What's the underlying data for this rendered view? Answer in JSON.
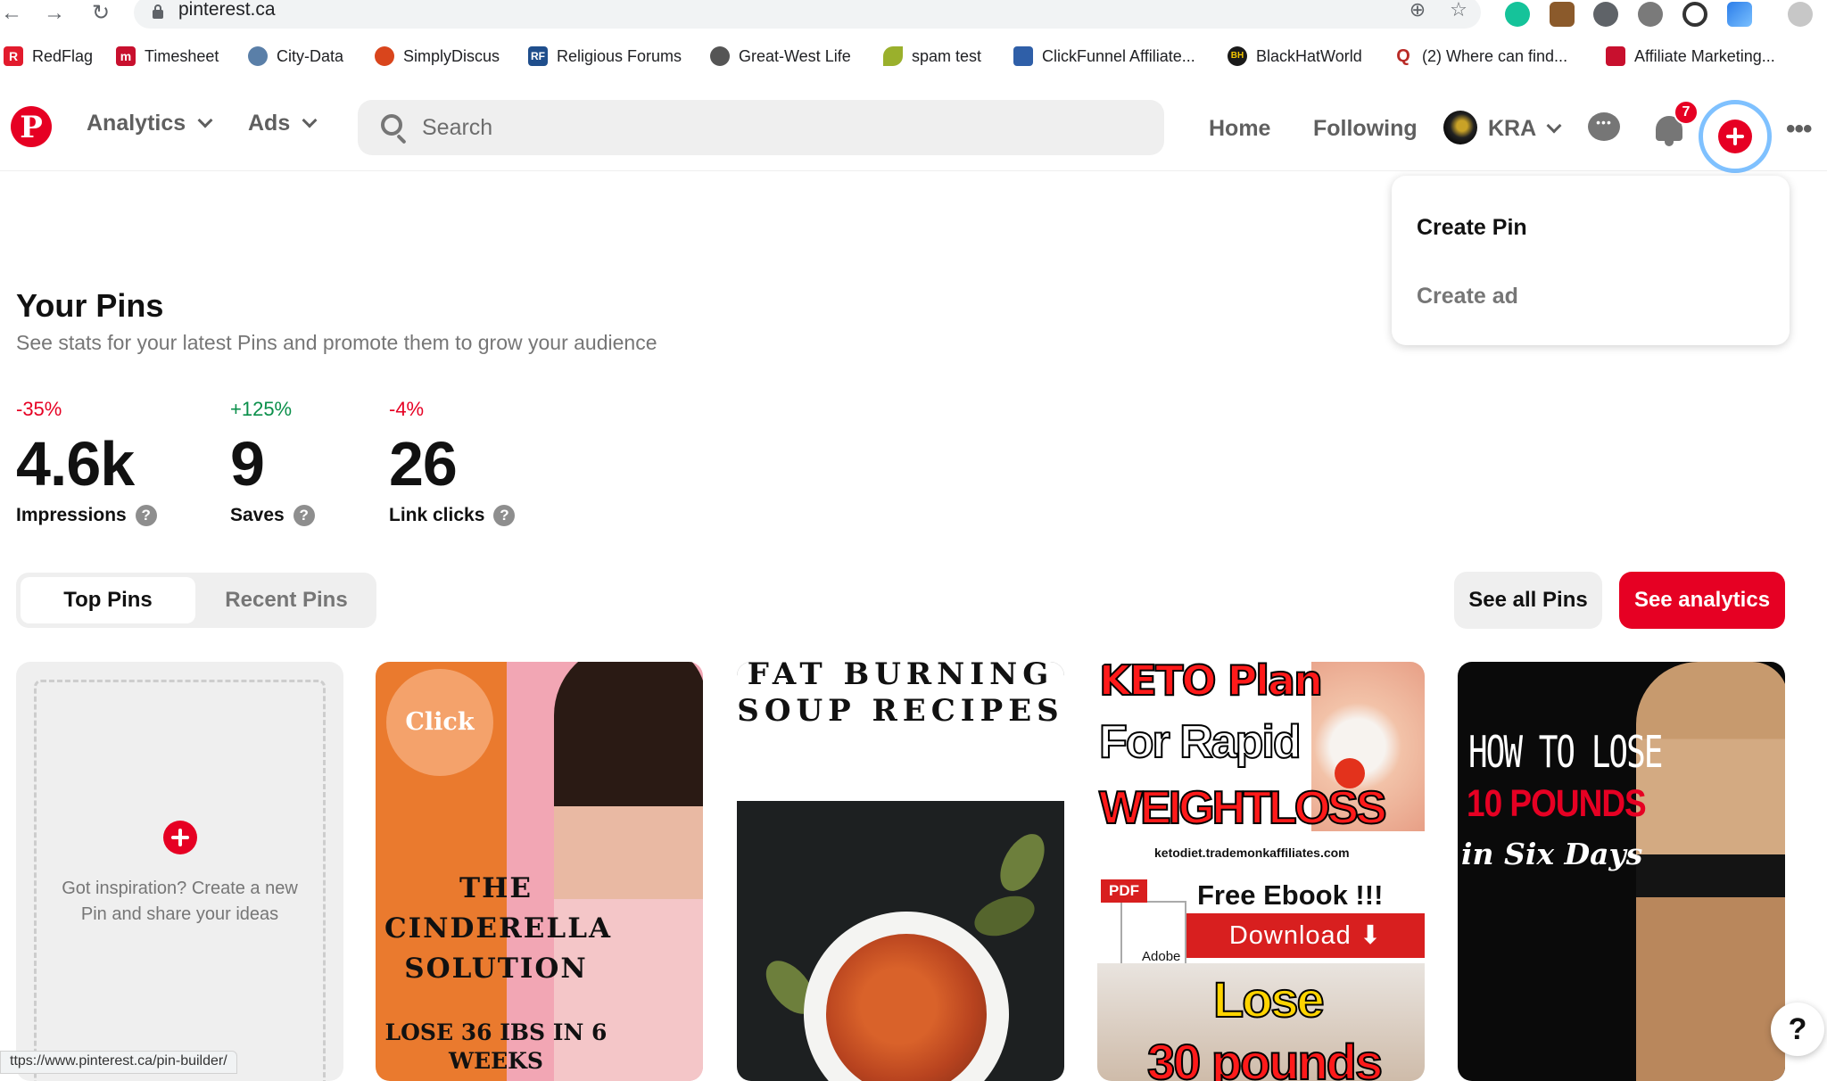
{
  "browser": {
    "url": "pinterest.ca",
    "bookmarks": [
      {
        "label": "RedFlag",
        "icon": "redflag-icon",
        "color": "#e21b2d"
      },
      {
        "label": "Timesheet",
        "icon": "timesheet-icon",
        "color": "#c8102e"
      },
      {
        "label": "City-Data",
        "icon": "city-data-icon",
        "color": "#5a7fa8"
      },
      {
        "label": "SimplyDiscus",
        "icon": "simplydiscus-icon",
        "color": "#d9451c"
      },
      {
        "label": "Religious Forums",
        "icon": "rf-icon",
        "color": "#1f4e8c"
      },
      {
        "label": "Great-West Life",
        "icon": "globe-icon",
        "color": "#555555"
      },
      {
        "label": "spam test",
        "icon": "leaf-icon",
        "color": "#9ab02c"
      },
      {
        "label": "ClickFunnel Affiliate...",
        "icon": "clickfunnel-icon",
        "color": "#2f5fa8"
      },
      {
        "label": "BlackHatWorld",
        "icon": "bhw-icon",
        "color": "#1a1a1a"
      },
      {
        "label": "(2) Where can find...",
        "icon": "quora-icon",
        "color": "#b92b27"
      },
      {
        "label": "Affiliate Marketing...",
        "icon": "affiliate-icon",
        "color": "#c8102e"
      }
    ]
  },
  "header": {
    "logo": "P",
    "menus": [
      "Analytics",
      "Ads"
    ],
    "search_placeholder": "Search",
    "links": [
      "Home",
      "Following"
    ],
    "account_name": "KRA",
    "notification_count": "7"
  },
  "create_menu": {
    "items": [
      "Create Pin",
      "Create ad"
    ]
  },
  "main": {
    "title": "Your Pins",
    "subtitle": "See stats for your latest Pins and promote them to grow your audience",
    "stats": [
      {
        "change": "-35%",
        "value": "4.6k",
        "label": "Impressions",
        "trend": "down"
      },
      {
        "change": "+125%",
        "value": "9",
        "label": "Saves",
        "trend": "up"
      },
      {
        "change": "-4%",
        "value": "26",
        "label": "Link clicks",
        "trend": "down"
      }
    ],
    "tabs": [
      "Top Pins",
      "Recent Pins"
    ],
    "active_tab": "Top Pins",
    "see_all_label": "See all Pins",
    "see_analytics_label": "See analytics",
    "create_card_text": "Got inspiration? Create a new Pin and share your ideas",
    "pins": [
      {
        "bubble": "Click",
        "title": "THE CINDERELLA SOLUTION",
        "subtitle": "LOSE 36 IBS IN 6 WEEKS"
      },
      {
        "title": "FAT BURNING SOUP RECIPES"
      },
      {
        "line1": "KETO Plan",
        "line2": "For Rapid",
        "line3": "WEIGHTLOSS",
        "url": "ketodiet.trademonkaffiliates.com",
        "pdf": "PDF",
        "adobe": "Adobe",
        "ebook": "Free Ebook !!!",
        "download": "Download ⬇",
        "lose": "Lose",
        "pounds": "30 pounds"
      },
      {
        "line1": "HOW TO LOSE",
        "line2": "10 POUNDS",
        "line3": "in Six Days"
      }
    ]
  },
  "status_url": "ttps://www.pinterest.ca/pin-builder/",
  "help_label": "?",
  "colors": {
    "brand": "#e60023",
    "positive": "#0a8f4a"
  }
}
